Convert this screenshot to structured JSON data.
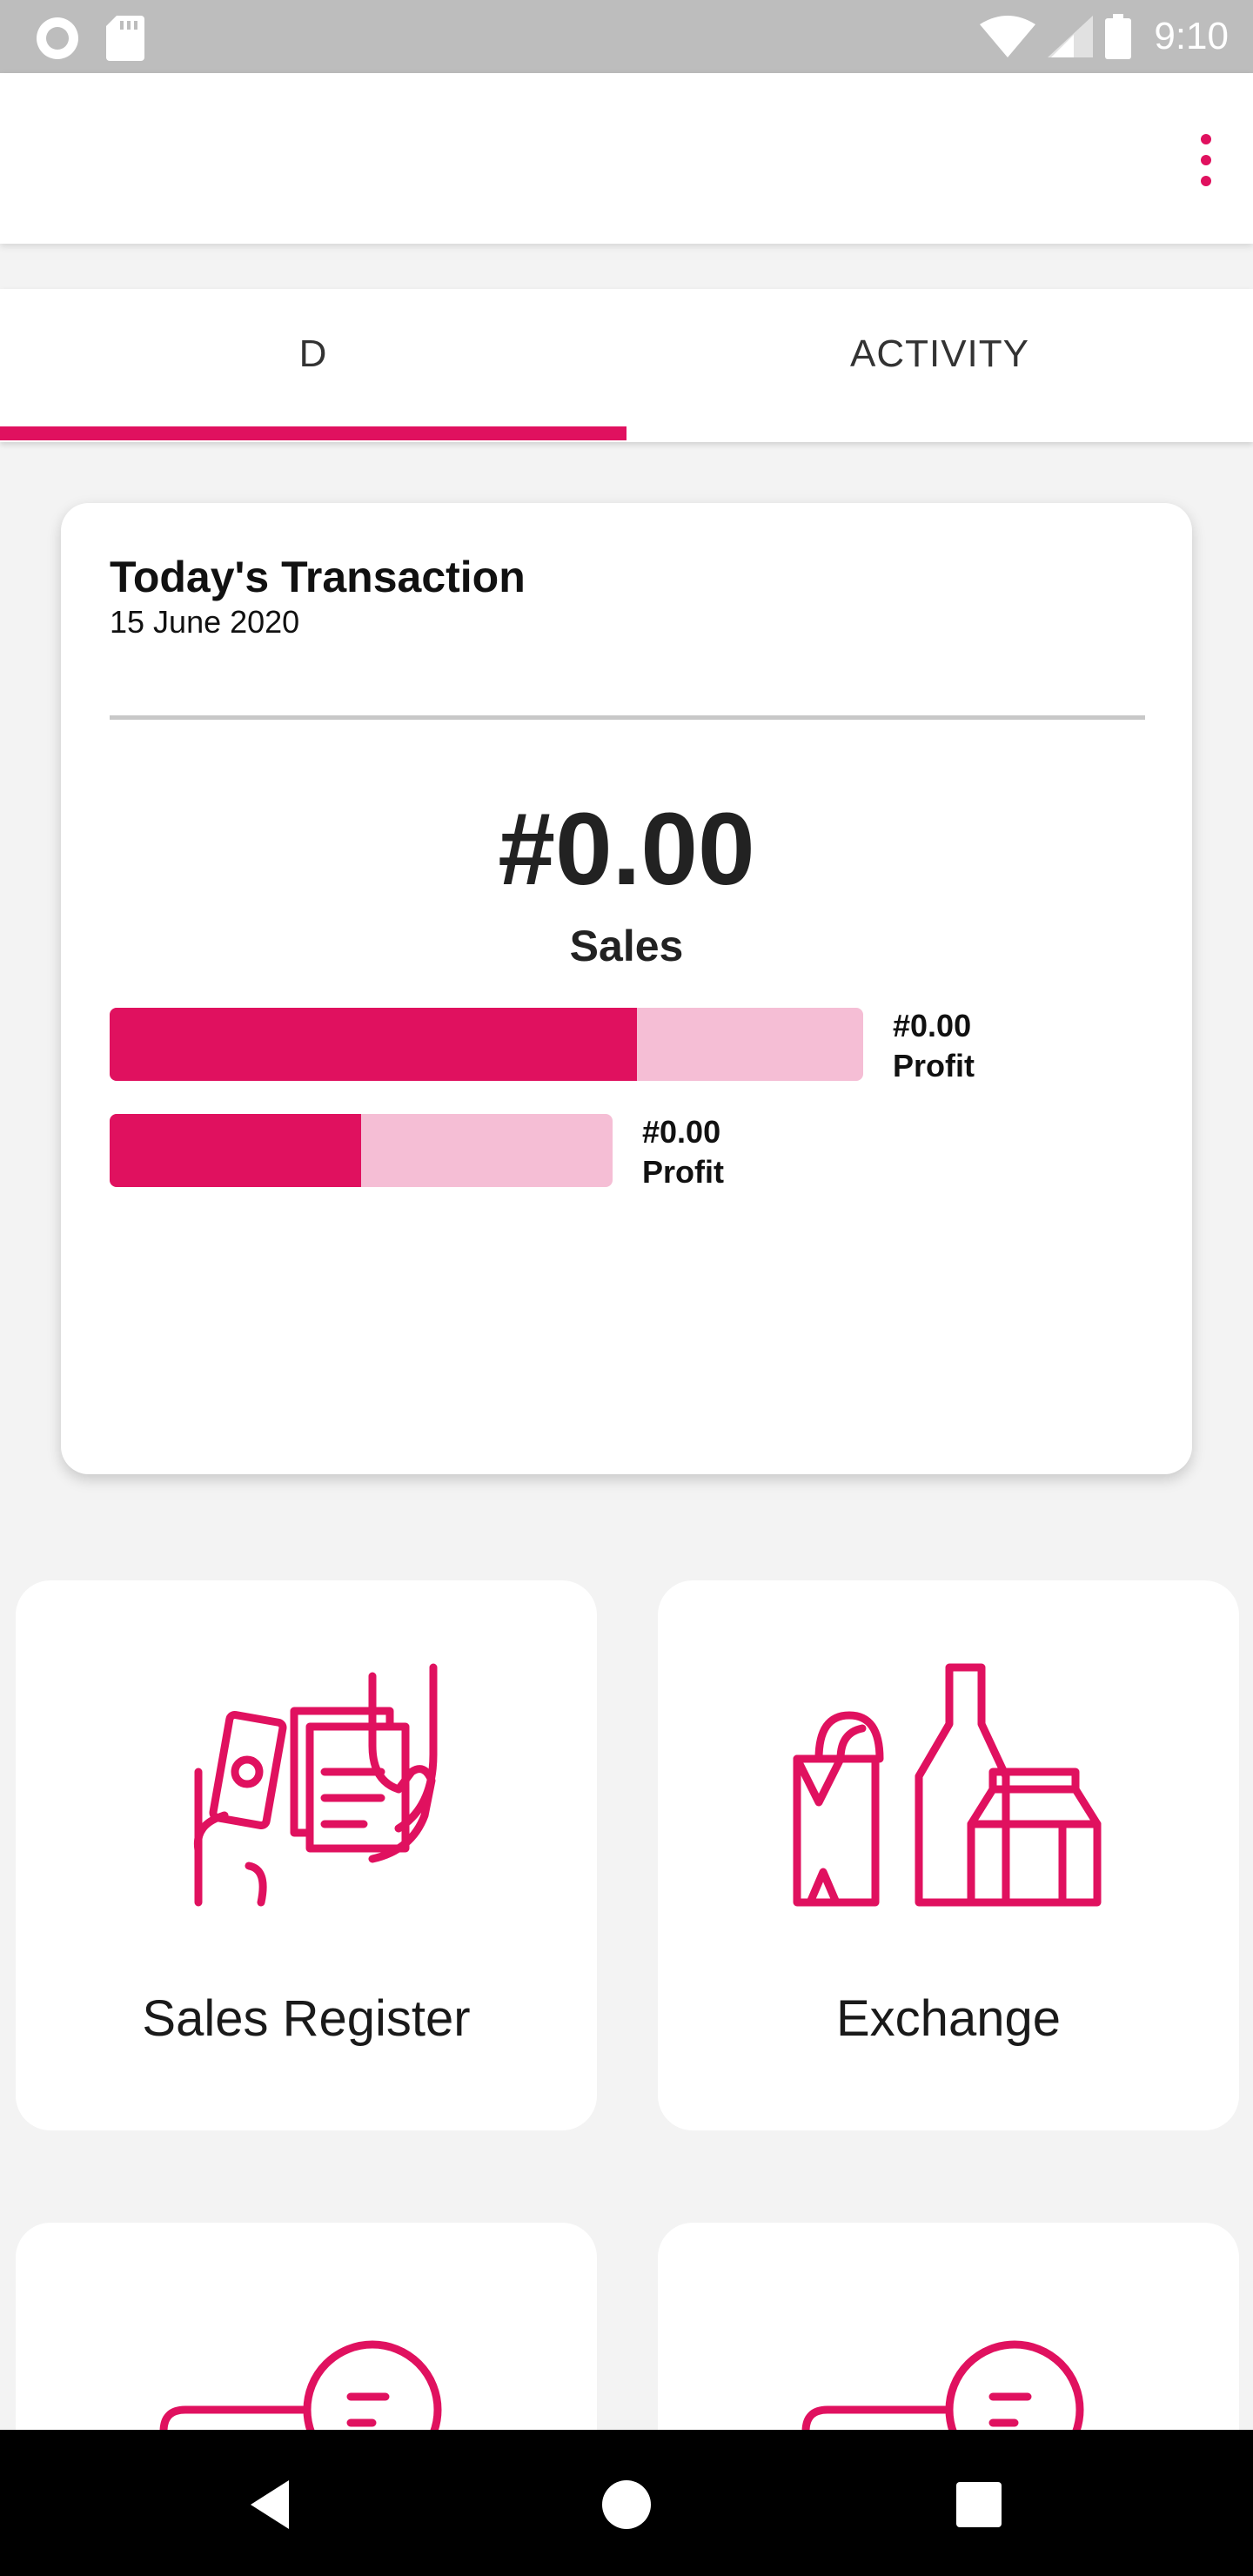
{
  "status_bar": {
    "time": "9:10",
    "left_icons": [
      "circle-notification-icon",
      "sd-card-icon"
    ],
    "right_icons": [
      "wifi-icon",
      "cellular-signal-icon",
      "battery-icon"
    ]
  },
  "app_bar": {
    "menu_icon": "more-vert-icon"
  },
  "tabs": [
    {
      "label": "D",
      "selected": true
    },
    {
      "label": "ACTIVITY",
      "selected": false
    }
  ],
  "transaction_card": {
    "title": "Today's Transaction",
    "date": "15 June 2020",
    "sales_amount": "#0.00",
    "sales_label": "Sales",
    "bars": [
      {
        "amount": "#0.00",
        "label": "Profit",
        "fill_fraction": 0.7
      },
      {
        "amount": "#0.00",
        "label": "Profit",
        "fill_fraction": 0.5
      }
    ]
  },
  "tiles": [
    {
      "label": "Sales Register",
      "icon": "cash-payment-icon"
    },
    {
      "label": "Exchange",
      "icon": "groceries-icon"
    },
    {
      "label": "",
      "icon": "chat-message-icon"
    },
    {
      "label": "",
      "icon": "chat-message-icon"
    }
  ],
  "colors": {
    "accent": "#e0115f",
    "accent_light": "#f5bed5",
    "background": "#f3f3f3",
    "status_bar": "#bdbdbd"
  },
  "nav_bar": {
    "buttons": [
      "back-icon",
      "home-icon",
      "recents-icon"
    ]
  }
}
